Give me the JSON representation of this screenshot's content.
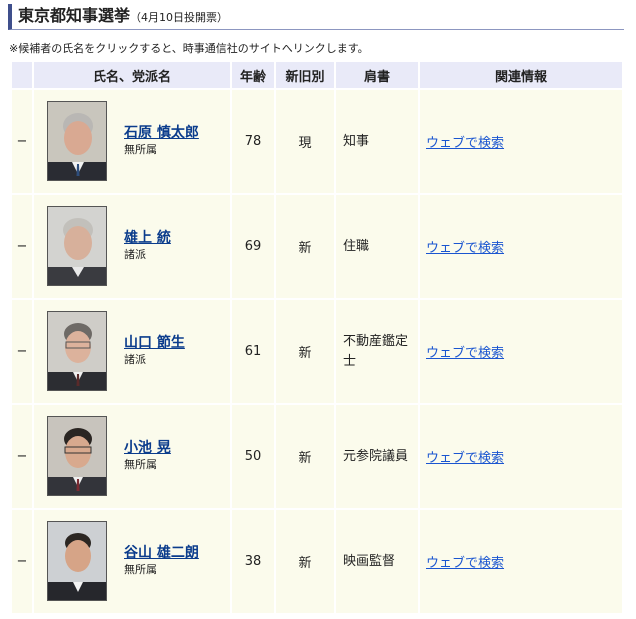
{
  "header": {
    "title": "東京都知事選挙",
    "subtitle": "（4月10日投開票）"
  },
  "note": "※候補者の氏名をクリックすると、時事通信社のサイトへリンクします。",
  "columns": {
    "name": "氏名、党派名",
    "age": "年齢",
    "status": "新旧別",
    "title": "肩書",
    "info": "関連情報"
  },
  "candidates": [
    {
      "mark": "−",
      "name": "石原 慎太郎",
      "party": "無所属",
      "age": "78",
      "status": "現",
      "title": "知事",
      "link": "ウェブで検索"
    },
    {
      "mark": "−",
      "name": "雄上 統",
      "party": "諸派",
      "age": "69",
      "status": "新",
      "title": "住職",
      "link": "ウェブで検索"
    },
    {
      "mark": "−",
      "name": "山口 節生",
      "party": "諸派",
      "age": "61",
      "status": "新",
      "title": "不動産鑑定士",
      "link": "ウェブで検索"
    },
    {
      "mark": "−",
      "name": "小池 晃",
      "party": "無所属",
      "age": "50",
      "status": "新",
      "title": "元参院議員",
      "link": "ウェブで検索"
    },
    {
      "mark": "−",
      "name": "谷山 雄二朗",
      "party": "無所属",
      "age": "38",
      "status": "新",
      "title": "映画監督",
      "link": "ウェブで検索"
    }
  ],
  "colors": {
    "accent": "#3f4f8c",
    "header_bg": "#e9eaf8",
    "row_bg": "#fbfbec",
    "link": "#1a55d0",
    "name_link": "#0b3c8c"
  }
}
